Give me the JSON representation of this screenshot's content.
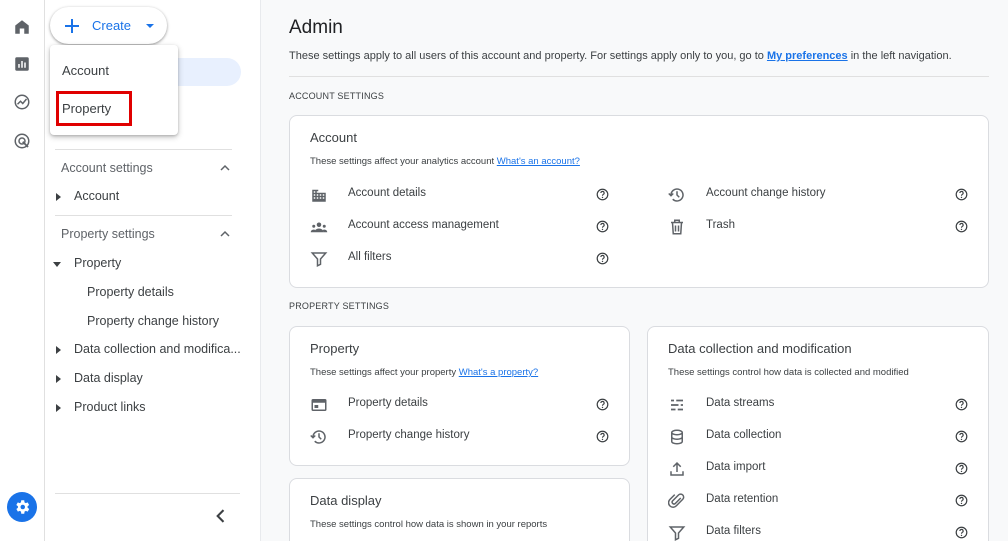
{
  "rail": {
    "items": [
      {
        "icon": "home-icon"
      },
      {
        "icon": "reports-icon"
      },
      {
        "icon": "explore-icon"
      },
      {
        "icon": "advertising-icon"
      }
    ],
    "settings_icon": "gear-icon"
  },
  "create": {
    "label": "Create",
    "menu": [
      "Account",
      "Property"
    ],
    "highlighted": "Property"
  },
  "sidebar": {
    "account_settings": {
      "title": "Account settings",
      "items": [
        "Account"
      ]
    },
    "property_settings": {
      "title": "Property settings",
      "property": "Property",
      "property_children": [
        "Property details",
        "Property change history"
      ],
      "items": [
        "Data collection and modifica...",
        "Data display",
        "Product links"
      ]
    }
  },
  "main": {
    "title": "Admin",
    "subtitle_pre": "These settings apply to all users of this account and property. For settings apply only to you, go to ",
    "subtitle_link": "My preferences",
    "subtitle_post": " in the left navigation.",
    "account_section_label": "ACCOUNT SETTINGS",
    "property_section_label": "PROPERTY SETTINGS",
    "account_card": {
      "title": "Account",
      "desc": "These settings affect your analytics account ",
      "desc_link": "What's an account?",
      "left_rows": [
        "Account details",
        "Account access management",
        "All filters"
      ],
      "right_rows": [
        "Account change history",
        "Trash"
      ]
    },
    "property_card": {
      "title": "Property",
      "desc": "These settings affect your property ",
      "desc_link": "What's a property?",
      "rows": [
        "Property details",
        "Property change history"
      ]
    },
    "data_display_card": {
      "title": "Data display",
      "desc": "These settings control how data is shown in your reports"
    },
    "data_collection_card": {
      "title": "Data collection and modification",
      "desc": "These settings control how data is collected and modified",
      "rows": [
        "Data streams",
        "Data collection",
        "Data import",
        "Data retention",
        "Data filters"
      ]
    }
  },
  "colors": {
    "accent": "#1a73e8",
    "highlight_box": "#e00000",
    "selected_pill": "#e8f0fe"
  }
}
